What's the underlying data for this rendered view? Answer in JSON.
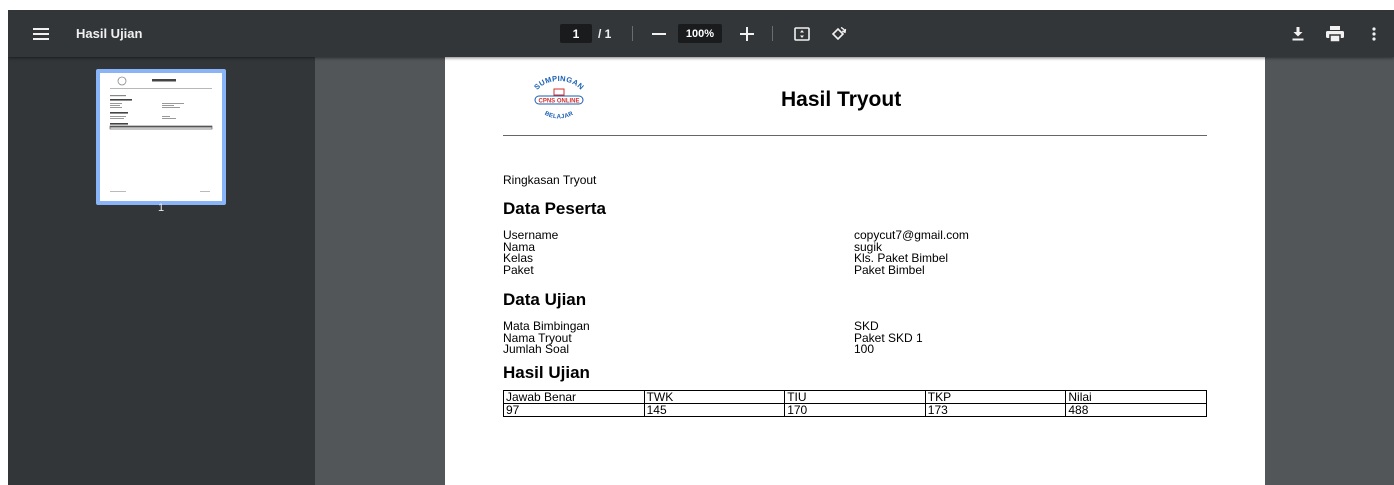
{
  "toolbar": {
    "title": "Hasil Ujian",
    "page_current": "1",
    "page_separator": "/ 1",
    "zoom": "100%"
  },
  "sidebar": {
    "thumbnails": [
      {
        "page_label": "1"
      }
    ]
  },
  "document": {
    "logo_text": {
      "top": "SUMPINGAN",
      "middle": "CPNS ONLINE",
      "bottom": "BELAJAR"
    },
    "title": "Hasil Tryout",
    "summary_label": "Ringkasan Tryout",
    "participant": {
      "heading": "Data Peserta",
      "labels": [
        "Username",
        "Nama",
        "Kelas",
        "Paket"
      ],
      "values": [
        "copycut7@gmail.com",
        "sugik",
        "Kls. Paket Bimbel",
        "Paket Bimbel"
      ]
    },
    "exam": {
      "heading": "Data Ujian",
      "labels": [
        "Mata Bimbingan",
        "Nama Tryout",
        "Jumlah Soal"
      ],
      "values": [
        "SKD",
        "Paket SKD 1",
        "100"
      ]
    },
    "results": {
      "heading": "Hasil Ujian",
      "headers": [
        "Jawab Benar",
        "TWK",
        "TIU",
        "TKP",
        "Nilai"
      ],
      "row": [
        "97",
        "145",
        "170",
        "173",
        "488"
      ]
    }
  },
  "colors": {
    "toolbar_bg": "#323639",
    "viewer_bg": "#525659",
    "thumb_highlight": "#8ab4f8",
    "logo_blue": "#1a5fb4",
    "logo_red": "#d32f2f"
  }
}
